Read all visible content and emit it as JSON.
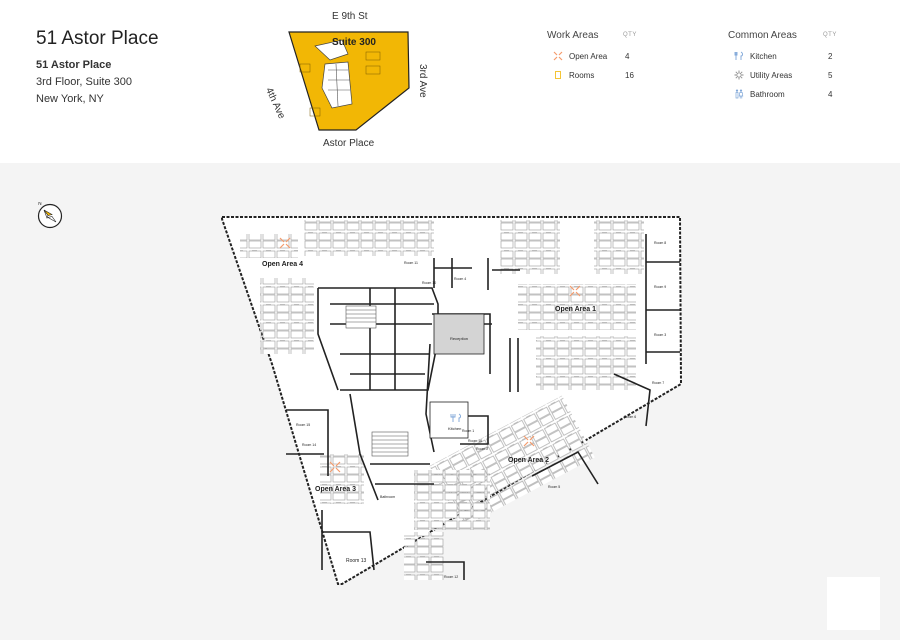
{
  "building": {
    "name": "51 Astor Place",
    "address_bold": "51 Astor Place",
    "floor_suite": "3rd Floor, Suite 300",
    "city": "New York, NY"
  },
  "keymap": {
    "suite_label": "Suite 300",
    "streets": {
      "north": "E 9th St",
      "west": "4th Ave",
      "east": "3rd Ave",
      "south": "Astor Place"
    }
  },
  "legend": {
    "qty_header": "QTY",
    "work": {
      "title": "Work Areas",
      "items": [
        {
          "label": "Open Area",
          "qty": "4",
          "icon": "open-area-icon"
        },
        {
          "label": "Rooms",
          "qty": "16",
          "icon": "room-icon"
        }
      ]
    },
    "common": {
      "title": "Common Areas",
      "items": [
        {
          "label": "Kitchen",
          "qty": "2",
          "icon": "kitchen-icon"
        },
        {
          "label": "Utility Areas",
          "qty": "5",
          "icon": "utility-icon"
        },
        {
          "label": "Bathroom",
          "qty": "4",
          "icon": "bathroom-icon"
        }
      ]
    }
  },
  "floorplan": {
    "areas": {
      "open4": "Open Area 4",
      "open1": "Open Area 1",
      "open2": "Open Area 2",
      "open3": "Open Area 3",
      "reception": "Reception",
      "kitchen": "Kitchen",
      "bathroom": "Bathroom"
    },
    "rooms": {
      "r1": "Room 1",
      "r2": "Room 2",
      "r3": "Room 3",
      "r4": "Room 4",
      "r5": "Room 5",
      "r6": "Room 6",
      "r7": "Room 7",
      "r8": "Room 8",
      "r9": "Room 9",
      "r10": "Room 10",
      "r11": "Room 11",
      "r12": "Room 12",
      "r13": "Room 13",
      "r14": "Room 14",
      "r15": "Room 15",
      "r16": "Room 16"
    }
  },
  "colors": {
    "suite_fill": "#f2b705",
    "accent": "#f59b6b",
    "common_icon": "#7ea6d8"
  }
}
